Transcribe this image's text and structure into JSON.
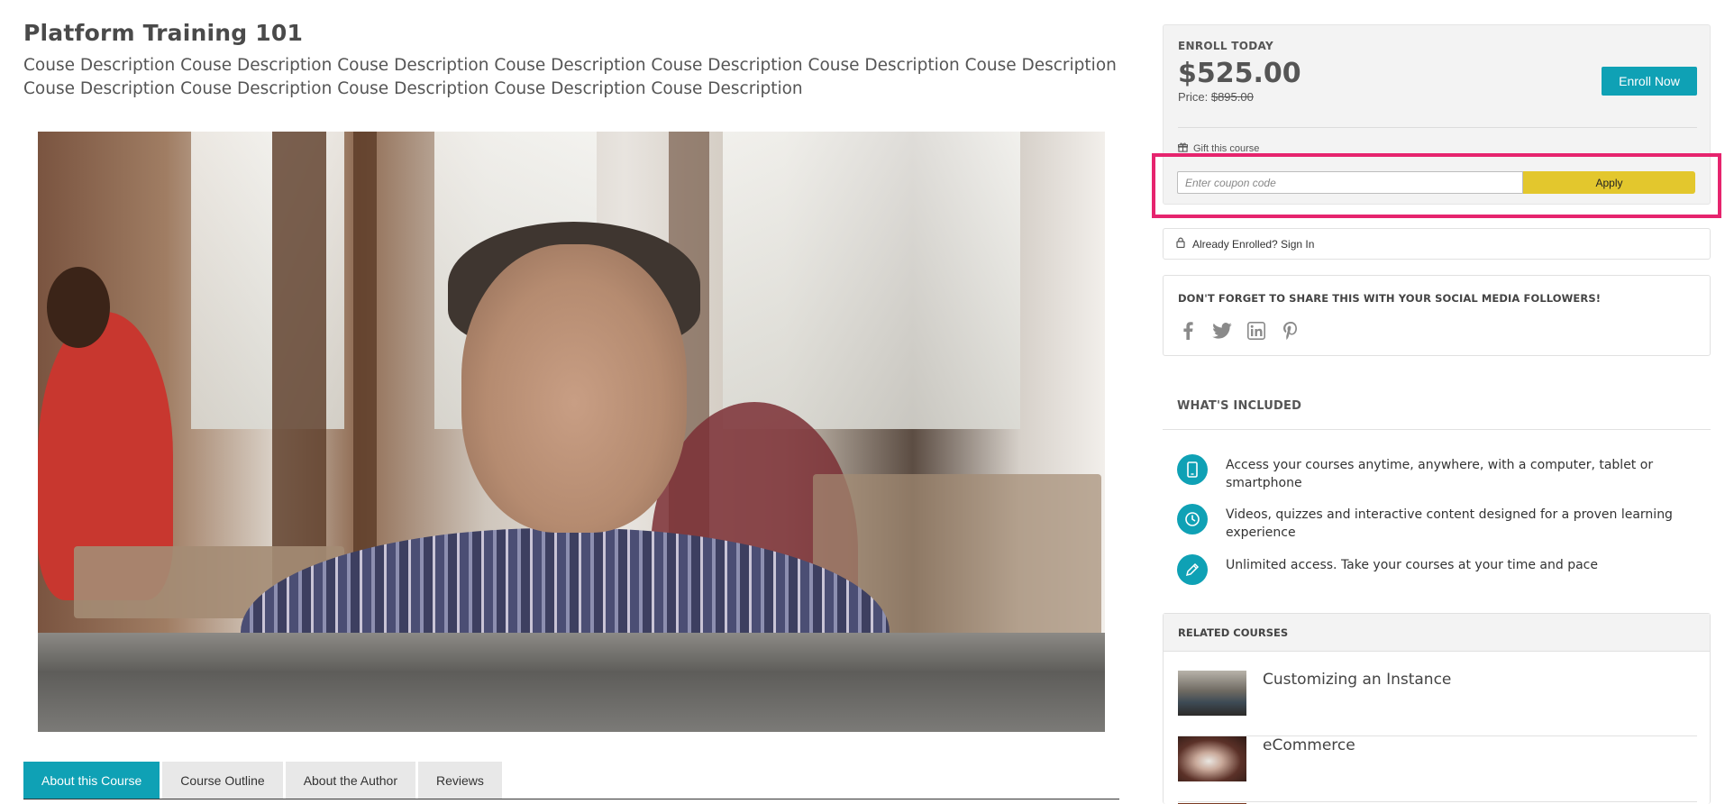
{
  "course": {
    "title": "Platform Training 101",
    "description": "Couse Description Couse Description Couse Description Couse Description Couse Description Couse Description Couse Description Couse Description Couse Description Couse Description Couse Description Couse Description"
  },
  "tabs": [
    {
      "label": "About this Course",
      "active": true
    },
    {
      "label": "Course Outline",
      "active": false
    },
    {
      "label": "About the Author",
      "active": false
    },
    {
      "label": "Reviews",
      "active": false
    }
  ],
  "enroll": {
    "label": "ENROLL TODAY",
    "price": "$525.00",
    "price_prefix": "Price: ",
    "original_price": "$895.00",
    "button": "Enroll Now",
    "gift": "Gift this course"
  },
  "coupon": {
    "placeholder": "Enter coupon code",
    "apply": "Apply"
  },
  "signin": {
    "label": "Already Enrolled? Sign In"
  },
  "share": {
    "title": "DON'T FORGET TO SHARE THIS WITH YOUR SOCIAL MEDIA FOLLOWERS!",
    "networks": [
      "facebook-icon",
      "twitter-icon",
      "linkedin-icon",
      "pinterest-icon"
    ]
  },
  "included": {
    "title": "WHAT'S INCLUDED",
    "items": [
      {
        "icon": "mobile-device-icon",
        "text": "Access your courses anytime, anywhere, with a computer, tablet or smartphone"
      },
      {
        "icon": "clock-icon",
        "text": "Videos, quizzes and interactive content designed for a proven learning experience"
      },
      {
        "icon": "pencil-icon",
        "text": "Unlimited access. Take your courses at your time and pace"
      }
    ]
  },
  "related": {
    "title": "RELATED COURSES",
    "items": [
      {
        "title": "Customizing an Instance"
      },
      {
        "title": "eCommerce"
      }
    ]
  },
  "colors": {
    "accent": "#0fa1b5",
    "apply": "#e3c72d",
    "highlight": "#e6246e"
  }
}
